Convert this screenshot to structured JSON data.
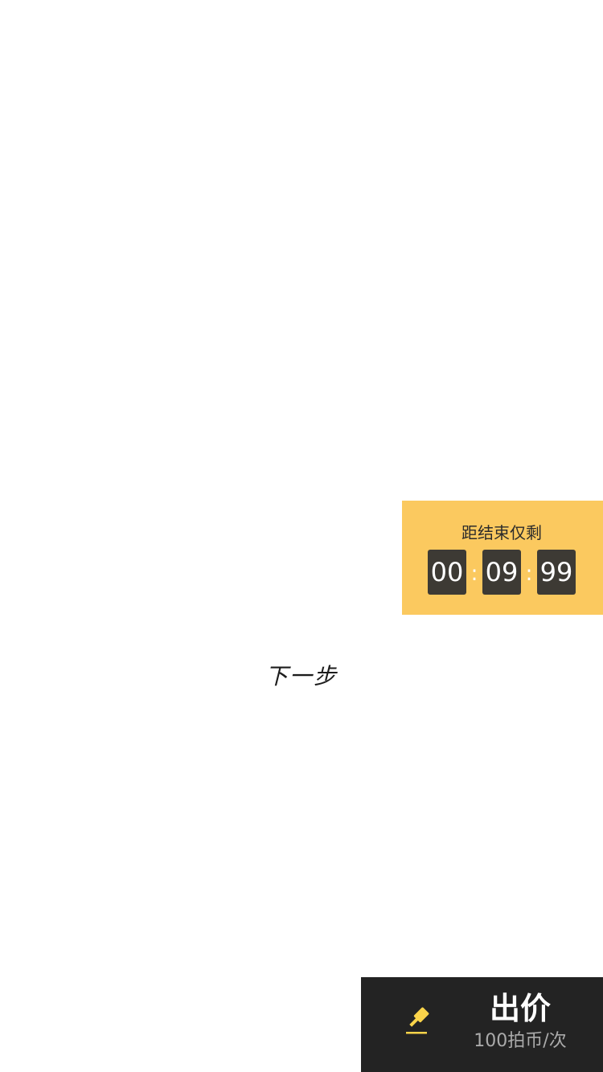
{
  "countdown": {
    "label": "距结束仅剩",
    "hours": "00",
    "minutes": "09",
    "seconds": "99",
    "separator": ":",
    "background_color": "#fbc95f",
    "digit_box_color": "#3d3a34"
  },
  "next_step": {
    "label": "下一步"
  },
  "bid_bar": {
    "title": "出价",
    "price_text": "100拍币/次",
    "icon": "gavel-icon",
    "icon_color": "#fbd44a",
    "background_color": "#232323"
  }
}
